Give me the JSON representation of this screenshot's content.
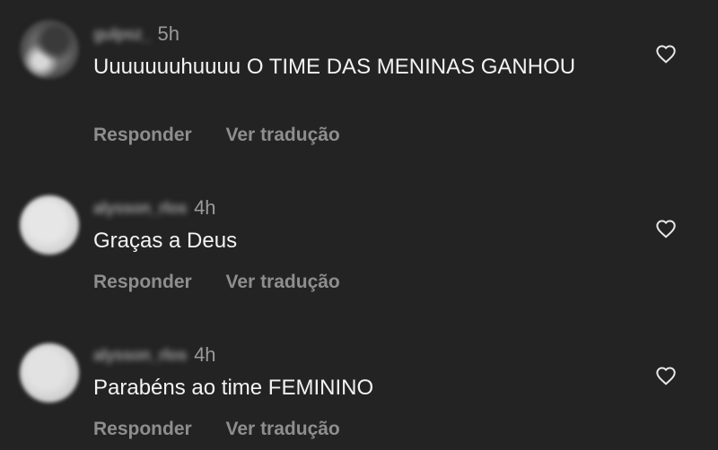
{
  "comments": [
    {
      "username": "gulpsz_",
      "time": "5h",
      "text": "Uuuuuuuhuuuu O TIME DAS MENINAS GANHOU",
      "reply_label": "Responder",
      "translate_label": "Ver tradução",
      "like_icon": "heart-outline-icon"
    },
    {
      "username": "alysson_rlos",
      "time": "4h",
      "text": "Graças a Deus",
      "reply_label": "Responder",
      "translate_label": "Ver tradução",
      "like_icon": "heart-outline-icon"
    },
    {
      "username": "alysson_rlos",
      "time": "4h",
      "text": "Parabéns ao time FEMININO",
      "reply_label": "Responder",
      "translate_label": "Ver tradução",
      "like_icon": "heart-outline-icon"
    }
  ]
}
